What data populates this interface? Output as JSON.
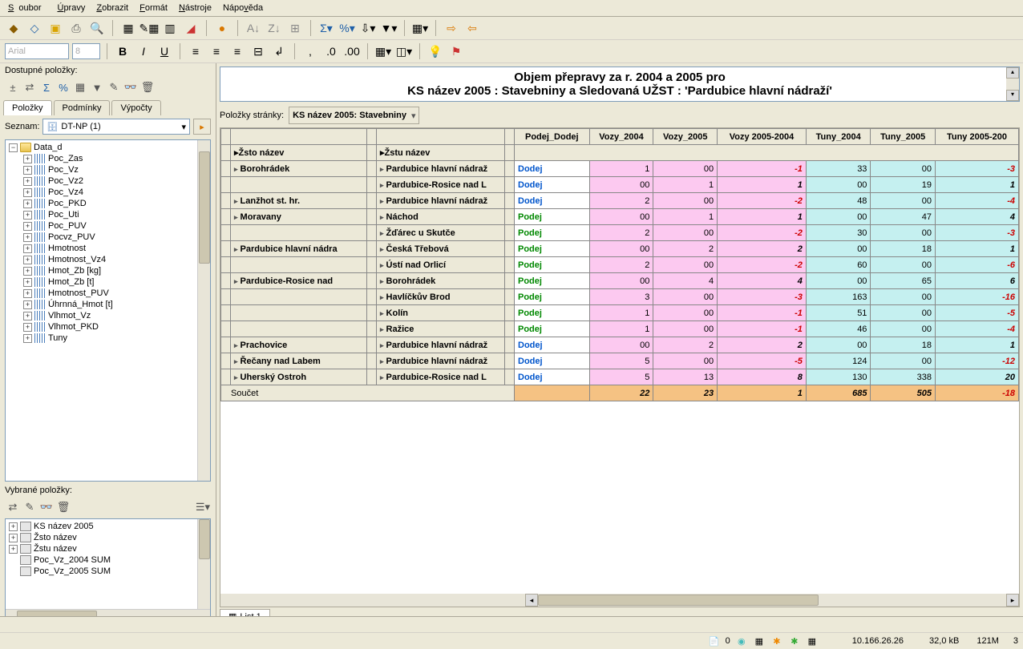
{
  "menu": [
    "Soubor",
    "Úpravy",
    "Zobrazit",
    "Formát",
    "Nástroje",
    "Nápověda"
  ],
  "menuAccel": [
    "S",
    "Ú",
    "Z",
    "F",
    "N",
    "N"
  ],
  "font": {
    "name": "Arial",
    "size": "8"
  },
  "leftPanel": {
    "dostupneLabel": "Dostupné položky:",
    "tabs": [
      "Položky",
      "Podmínky",
      "Výpočty"
    ],
    "seznamLabel": "Seznam:",
    "seznamValue": "DT-NP (1)",
    "treeRoot": "Data_d",
    "treeItems": [
      "Poc_Zas",
      "Poc_Vz",
      "Poc_Vz2",
      "Poc_Vz4",
      "Poc_PKD",
      "Poc_Uti",
      "Poc_PUV",
      "Pocvz_PUV",
      "Hmotnost",
      "Hmotnost_Vz4",
      "Hmot_Zb [kg]",
      "Hmot_Zb [t]",
      "Hmotnost_PUV",
      "Úhrnná_Hmot  [t]",
      "Vlhmot_Vz",
      "Vlhmot_PKD",
      "Tuny"
    ],
    "vybraneLabel": "Vybrané položky:",
    "selectedItems": [
      "KS název 2005",
      "Žsto název",
      "Žstu název",
      "Poc_Vz_2004 SUM",
      "Poc_Vz_2005 SUM"
    ]
  },
  "report": {
    "titleLine1": "Objem přepravy za r. 2004 a 2005 pro",
    "titleLine2": "KS název 2005 : Stavebniny a Sledovaná UŽST : 'Pardubice hlavní nádraží'",
    "pageItemsLabel": "Položky stránky:",
    "pageFilter": "KS název 2005:  Stavebniny"
  },
  "grid": {
    "rowHeaders": [
      "Žsto název",
      "Žstu název"
    ],
    "columns": [
      "Podej_Dodej",
      "Vozy_2004",
      "Vozy_2005",
      "Vozy 2005-2004",
      "Tuny_2004",
      "Tuny_2005",
      "Tuny 2005-200"
    ],
    "rows": [
      {
        "zsto": "Borohrádek",
        "zstu": "Pardubice hlavní nádraž",
        "pd": "Dodej",
        "v04": "1",
        "v05": "00",
        "vd": "-1",
        "t04": "33",
        "t05": "00",
        "td": "-3"
      },
      {
        "zsto": "",
        "zstu": "Pardubice-Rosice nad L",
        "pd": "Dodej",
        "v04": "00",
        "v05": "1",
        "vd": "1",
        "t04": "00",
        "t05": "19",
        "td": "1"
      },
      {
        "zsto": "Lanžhot st. hr.",
        "zstu": "Pardubice hlavní nádraž",
        "pd": "Dodej",
        "v04": "2",
        "v05": "00",
        "vd": "-2",
        "t04": "48",
        "t05": "00",
        "td": "-4"
      },
      {
        "zsto": "Moravany",
        "zstu": "Náchod",
        "pd": "Podej",
        "v04": "00",
        "v05": "1",
        "vd": "1",
        "t04": "00",
        "t05": "47",
        "td": "4"
      },
      {
        "zsto": "",
        "zstu": "Žďárec u Skutče",
        "pd": "Podej",
        "v04": "2",
        "v05": "00",
        "vd": "-2",
        "t04": "30",
        "t05": "00",
        "td": "-3"
      },
      {
        "zsto": "Pardubice hlavní nádra",
        "zstu": "Česká Třebová",
        "pd": "Podej",
        "v04": "00",
        "v05": "2",
        "vd": "2",
        "t04": "00",
        "t05": "18",
        "td": "1"
      },
      {
        "zsto": "",
        "zstu": "Ústí nad Orlicí",
        "pd": "Podej",
        "v04": "2",
        "v05": "00",
        "vd": "-2",
        "t04": "60",
        "t05": "00",
        "td": "-6"
      },
      {
        "zsto": "Pardubice-Rosice nad",
        "zstu": "Borohrádek",
        "pd": "Podej",
        "v04": "00",
        "v05": "4",
        "vd": "4",
        "t04": "00",
        "t05": "65",
        "td": "6"
      },
      {
        "zsto": "",
        "zstu": "Havlíčkův Brod",
        "pd": "Podej",
        "v04": "3",
        "v05": "00",
        "vd": "-3",
        "t04": "163",
        "t05": "00",
        "td": "-16"
      },
      {
        "zsto": "",
        "zstu": "Kolín",
        "pd": "Podej",
        "v04": "1",
        "v05": "00",
        "vd": "-1",
        "t04": "51",
        "t05": "00",
        "td": "-5"
      },
      {
        "zsto": "",
        "zstu": "Ražice",
        "pd": "Podej",
        "v04": "1",
        "v05": "00",
        "vd": "-1",
        "t04": "46",
        "t05": "00",
        "td": "-4"
      },
      {
        "zsto": "Prachovice",
        "zstu": "Pardubice hlavní nádraž",
        "pd": "Dodej",
        "v04": "00",
        "v05": "2",
        "vd": "2",
        "t04": "00",
        "t05": "18",
        "td": "1"
      },
      {
        "zsto": "Řečany nad Labem",
        "zstu": "Pardubice hlavní nádraž",
        "pd": "Dodej",
        "v04": "5",
        "v05": "00",
        "vd": "-5",
        "t04": "124",
        "t05": "00",
        "td": "-12"
      },
      {
        "zsto": "Uherský Ostroh",
        "zstu": "Pardubice-Rosice nad L",
        "pd": "Dodej",
        "v04": "5",
        "v05": "13",
        "vd": "8",
        "t04": "130",
        "t05": "338",
        "td": "20"
      }
    ],
    "sumLabel": "Součet",
    "sum": {
      "v04": "22",
      "v05": "23",
      "vd": "1",
      "t04": "685",
      "t05": "505",
      "td": "-18"
    }
  },
  "sheetTab": "List 1",
  "status": {
    "docCount": "0",
    "ip": "10.166.26.26",
    "size": "32,0 kB",
    "mem": "121M",
    "n": "3"
  }
}
